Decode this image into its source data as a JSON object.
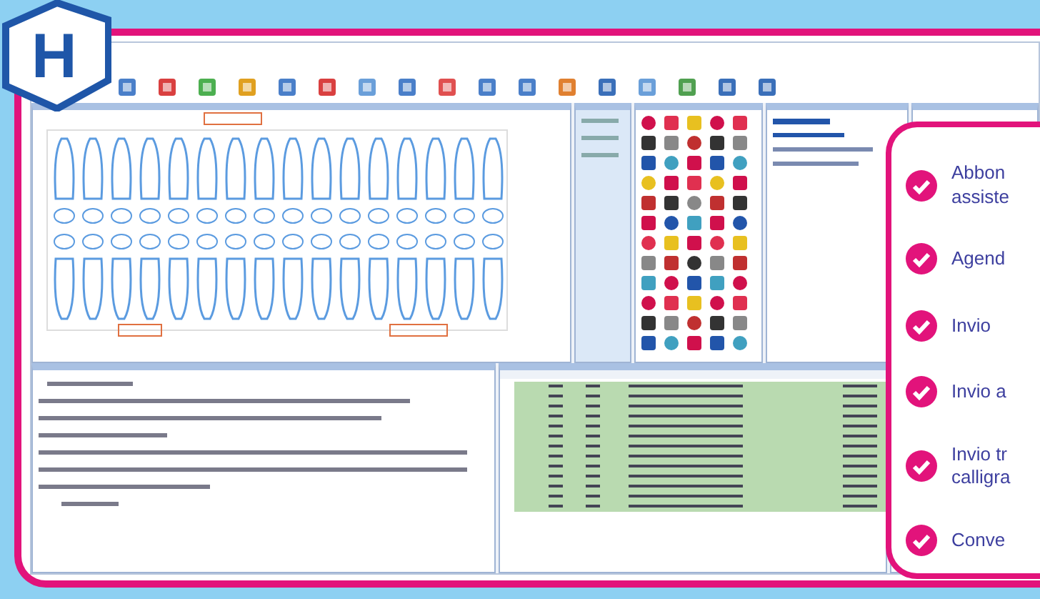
{
  "logo": {
    "letter": "H"
  },
  "features": [
    {
      "lines": [
        "Abbon",
        "assiste"
      ]
    },
    {
      "lines": [
        "Agend"
      ]
    },
    {
      "lines": [
        "Invio"
      ]
    },
    {
      "lines": [
        "Invio a"
      ]
    },
    {
      "lines": [
        "Invio tr",
        "calligra"
      ]
    },
    {
      "lines": [
        "Conve"
      ]
    }
  ]
}
